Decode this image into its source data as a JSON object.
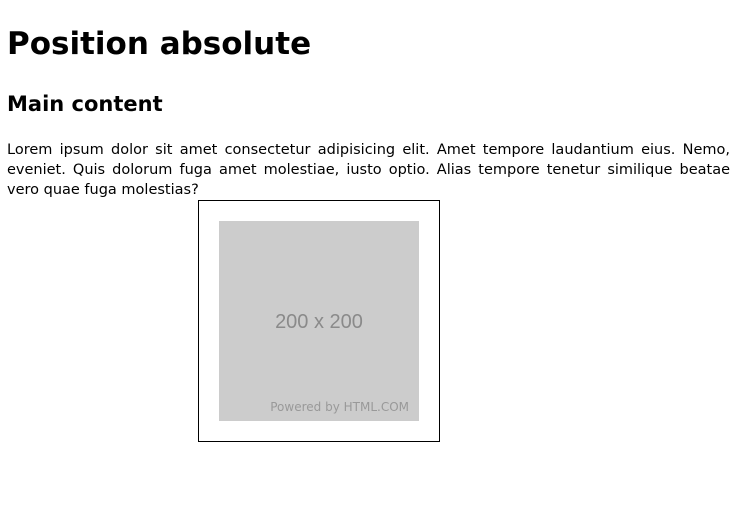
{
  "title": "Position absolute",
  "subtitle": "Main content",
  "paragraph": "Lorem ipsum dolor sit amet consectetur adipisicing elit. Amet tempore laudantium eius. Nemo, eveniet. Quis dolorum fuga amet molestiae, iusto optio. Alias tempore tenetur similique beatae vero quae fuga molestias?",
  "image": {
    "dimensions": "200 x 200",
    "credit": "Powered by HTML.COM"
  }
}
